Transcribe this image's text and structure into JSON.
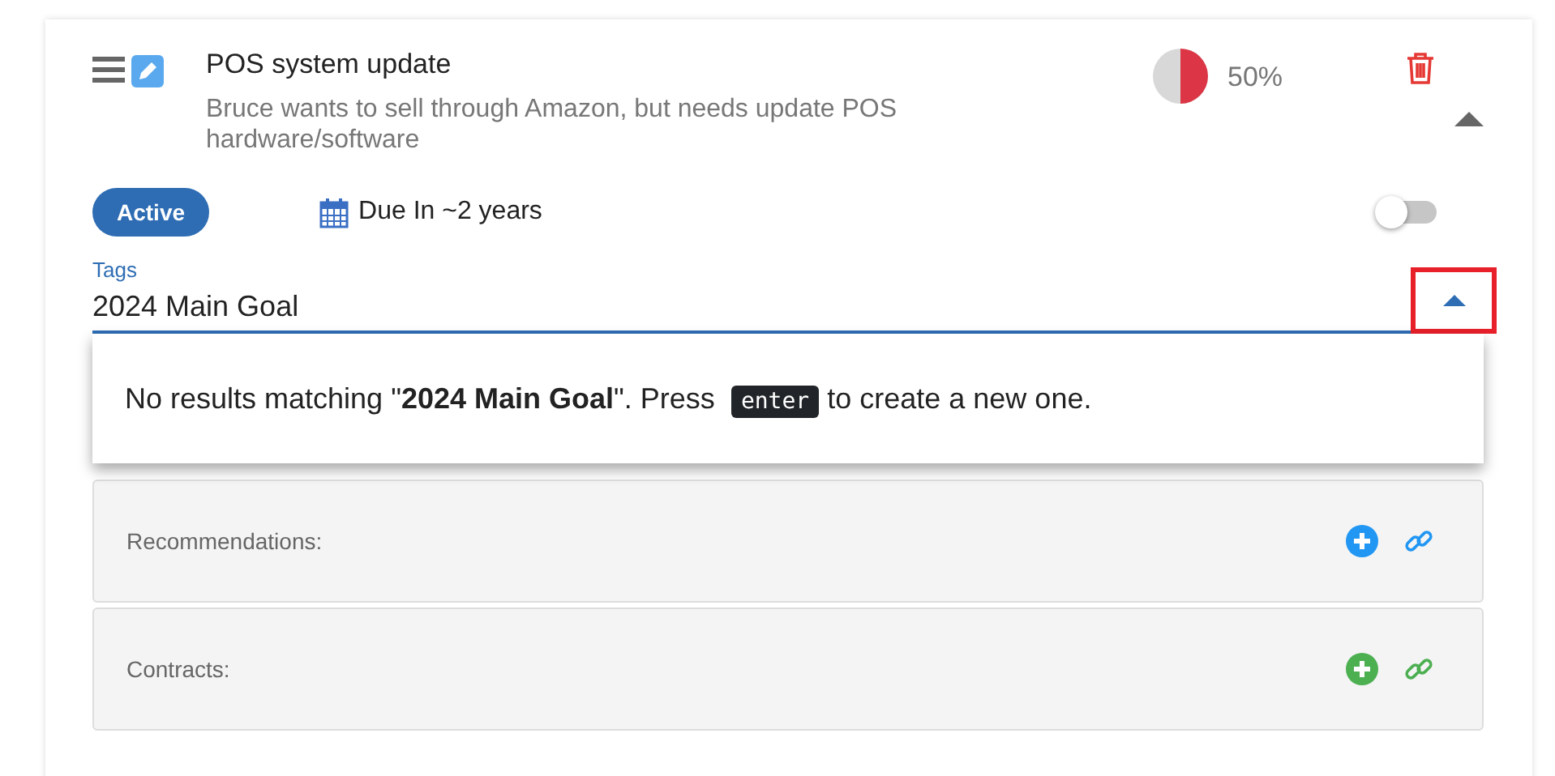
{
  "goal": {
    "title": "POS system update",
    "description": "Bruce wants to sell through Amazon, but needs update POS hardware/software",
    "progress": {
      "reading": "50%"
    },
    "expanded": true
  },
  "status": {
    "label": "Active"
  },
  "due": {
    "label": "Due In ~2 years"
  },
  "toggle": {
    "on": false
  },
  "tags": {
    "label": "Tags",
    "value": "2024 Main Goal",
    "open": true,
    "highlighted": true
  },
  "dropdown": {
    "before": "No results matching \"**2024 Main Goal**\". Press",
    "key": "enter",
    "after": "to create a new one."
  },
  "sections": [
    {
      "label": "Recommendations:",
      "color": "#2196f3"
    },
    {
      "label": "Contracts:",
      "color": "#4caf50"
    }
  ]
}
